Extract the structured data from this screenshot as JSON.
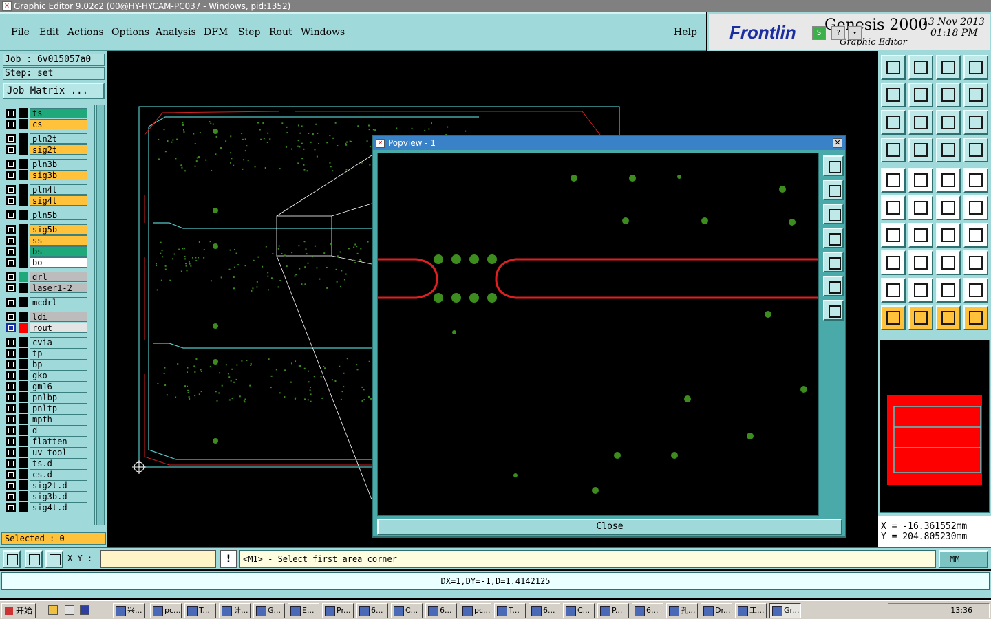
{
  "window": {
    "title": "Graphic Editor 9.02c2 (00@HY-HYCAM-PC037 - Windows, pid:1352)"
  },
  "menu": [
    {
      "label": "File"
    },
    {
      "label": "Edit"
    },
    {
      "label": "Actions"
    },
    {
      "label": "Options"
    },
    {
      "label": "Analysis"
    },
    {
      "label": "DFM"
    },
    {
      "label": "Step"
    },
    {
      "label": "Rout"
    },
    {
      "label": "Windows"
    },
    {
      "label": "Help"
    }
  ],
  "brand": {
    "logo": "Frontlin",
    "product": "Genesis 2000",
    "subtitle": "Graphic Editor",
    "date": "13 Nov 2013",
    "time": "01:18 PM",
    "s_button": "S",
    "q_button": "?",
    "arrow_button": "▾"
  },
  "job": {
    "job_line": "Job : 6v015057a0",
    "step_line": "Step: set",
    "matrix_button": "Job Matrix ..."
  },
  "layers": [
    {
      "name": "ts",
      "color": "#1fa87a"
    },
    {
      "name": "cs",
      "color": "#ffc23a"
    },
    {
      "name": "pln2t",
      "color": "#9fd9d9"
    },
    {
      "name": "sig2t",
      "color": "#ffc23a"
    },
    {
      "name": "pln3b",
      "color": "#9fd9d9"
    },
    {
      "name": "sig3b",
      "color": "#ffc23a"
    },
    {
      "name": "pln4t",
      "color": "#9fd9d9"
    },
    {
      "name": "sig4t",
      "color": "#ffc23a"
    },
    {
      "name": "pln5b",
      "color": "#9fd9d9"
    },
    {
      "name": "sig5b",
      "color": "#ffc23a"
    },
    {
      "name": "ss",
      "color": "#ffc23a"
    },
    {
      "name": "bs",
      "color": "#1fa87a"
    },
    {
      "name": "bo",
      "color": "#ffffff"
    },
    {
      "name": "drl",
      "color": "#bcbcbc",
      "swatch": "#1fa87a"
    },
    {
      "name": "laser1-2",
      "color": "#bcbcbc"
    },
    {
      "name": "mcdrl",
      "color": "#9fd9d9"
    },
    {
      "name": "ldi",
      "color": "#bcbcbc"
    },
    {
      "name": "rout",
      "color": "#e4e4e4",
      "swatch": "#ff0000",
      "active": true
    },
    {
      "name": "cvia",
      "color": "#9fd9d9"
    },
    {
      "name": "tp",
      "color": "#9fd9d9"
    },
    {
      "name": "bp",
      "color": "#9fd9d9"
    },
    {
      "name": "gko",
      "color": "#9fd9d9"
    },
    {
      "name": "gm16",
      "color": "#9fd9d9"
    },
    {
      "name": "pnlbp",
      "color": "#9fd9d9"
    },
    {
      "name": "pnltp",
      "color": "#9fd9d9"
    },
    {
      "name": "mpth",
      "color": "#9fd9d9"
    },
    {
      "name": "d",
      "color": "#9fd9d9"
    },
    {
      "name": "flatten",
      "color": "#9fd9d9"
    },
    {
      "name": "uv_tool",
      "color": "#9fd9d9"
    },
    {
      "name": "ts.d",
      "color": "#9fd9d9"
    },
    {
      "name": "cs.d",
      "color": "#9fd9d9"
    },
    {
      "name": "sig2t.d",
      "color": "#9fd9d9"
    },
    {
      "name": "sig3b.d",
      "color": "#9fd9d9"
    },
    {
      "name": "sig4t.d",
      "color": "#9fd9d9"
    }
  ],
  "selected": "Selected : 0",
  "popview": {
    "title": "Popview - 1",
    "close_label": "Close"
  },
  "coords": {
    "x": "X  =  -16.361552mm",
    "y": "Y  =  204.805230mm"
  },
  "command": {
    "xy_label": "X Y :",
    "xy_value": "",
    "prompt": "<M1> - Select first area corner",
    "units": "MM"
  },
  "status": "DX=1,DY=-1,D=1.4142125",
  "taskbar": {
    "start": "开始",
    "tasks": [
      "兴...",
      "pc...",
      "T...",
      "计...",
      "G...",
      "E...",
      "Pr...",
      "6...",
      "C...",
      "6...",
      "pc...",
      "T...",
      "6...",
      "C...",
      "P...",
      "6...",
      "孔...",
      "Dr...",
      "工...",
      "Gr..."
    ],
    "clock": "13:36"
  },
  "colors": {
    "teal": "#9fd9d9",
    "rout": "#ff0000",
    "pad": "#3c8c1e",
    "outline": "#55c8c8"
  }
}
